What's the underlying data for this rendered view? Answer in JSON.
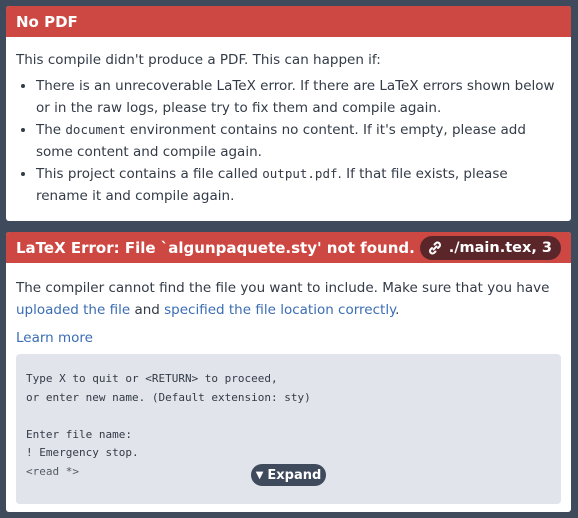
{
  "no_pdf": {
    "title": "No PDF",
    "intro": "This compile didn't produce a PDF. This can happen if:",
    "reason1": "There is an unrecoverable LaTeX error. If there are LaTeX errors shown below or in the raw logs, please try to fix them and compile again.",
    "reason2_pre": "The ",
    "reason2_code": "document",
    "reason2_post": " environment contains no content. If it's empty, please add some content and compile again.",
    "reason3_pre": "This project contains a file called ",
    "reason3_code": "output.pdf",
    "reason3_post": ". If that file exists, please rename it and compile again."
  },
  "latex_error": {
    "title": "LaTeX Error: File `algunpaquete.sty' not found.",
    "file_ref": "./main.tex, 3",
    "link_icon": "link-icon",
    "desc_pre": "The compiler cannot find the file you want to include. Make sure that you have ",
    "link_uploaded": "uploaded the file",
    "desc_mid": " and ",
    "link_location": "specified the file location correctly",
    "desc_post": ".",
    "learn_more": "Learn more",
    "log": "Type X to quit or <RETURN> to proceed,\nor enter new name. (Default extension: sty)\n\nEnter file name:\n! Emergency stop.\n<read *>",
    "expand_label": "Expand",
    "expand_icon": "chevron-down-icon"
  },
  "colors": {
    "header_red": "#ce4843",
    "badge_dark": "#5a2629",
    "link_blue": "#3b6db4",
    "background": "#3f4b5c"
  }
}
